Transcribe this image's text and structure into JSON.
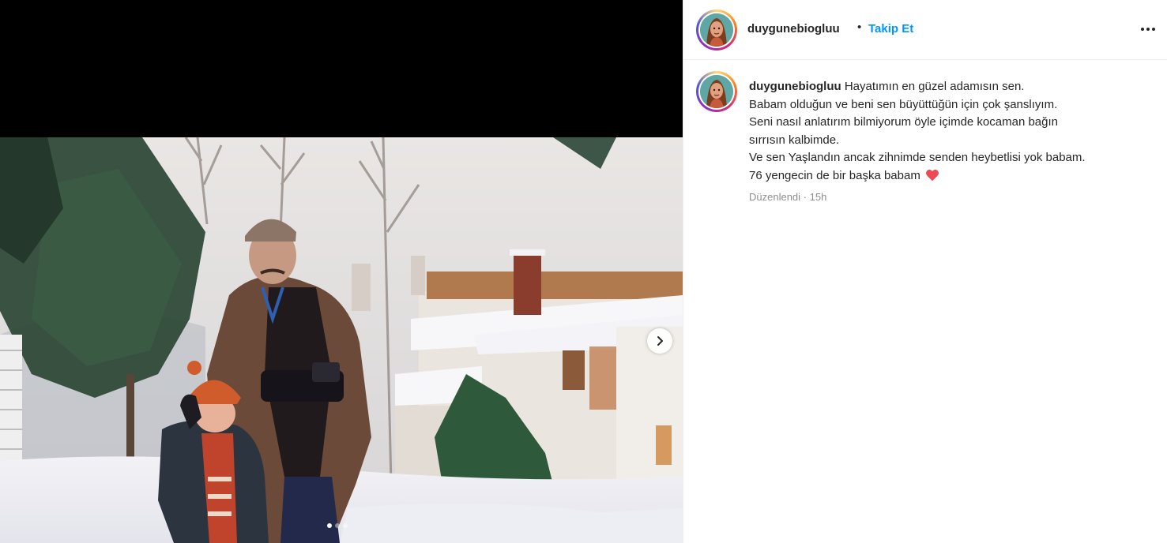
{
  "post": {
    "username": "duygunebiogluu",
    "separator": "•",
    "follow_label": "Takip Et",
    "more_icon": "more-horizontal-icon",
    "caption_lines": [
      "Hayatımın en güzel adamısın sen.",
      "Babam olduğun ve beni sen büyüttüğün için çok şanslıyım.",
      "Seni nasıl anlatırım bilmiyorum öyle içimde kocaman bağın",
      "sırrısın kalbimde.",
      "Ve sen Yaşlandın ancak zihnimde senden heybetlisi yok babam.",
      "76 yengecin de bir başka babam"
    ],
    "caption_emoji": "red-heart-icon",
    "edited_label": "Düzenlendi",
    "meta_separator": "·",
    "time_ago": "15h"
  },
  "carousel": {
    "slide_count": 3,
    "active_slide": 1,
    "next_icon": "chevron-right-icon"
  },
  "colors": {
    "accent": "#0095f6",
    "text": "#262626",
    "muted": "#8e8e8e",
    "heart": "#ed4956"
  }
}
